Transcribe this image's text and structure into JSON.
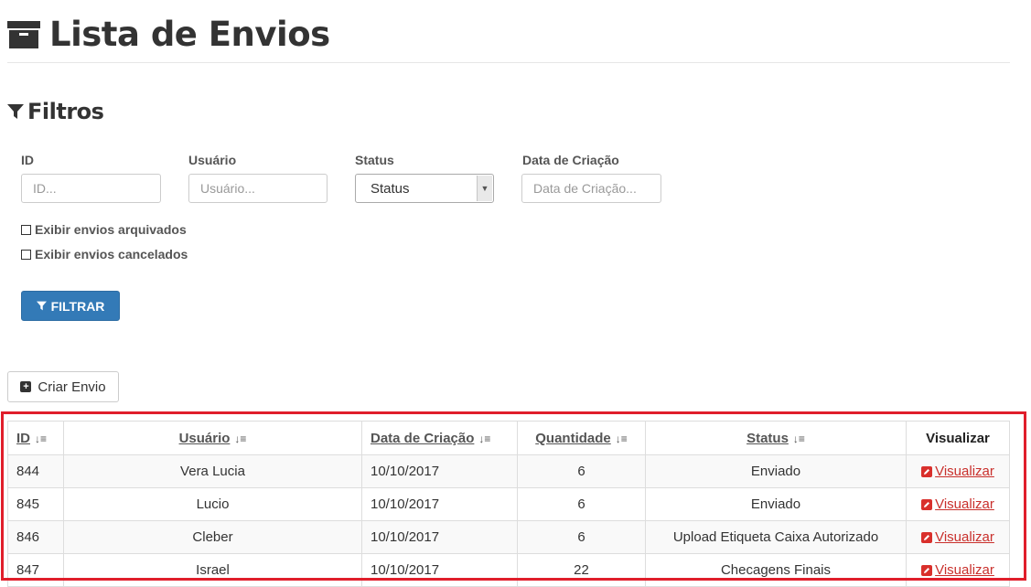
{
  "header": {
    "title": "Lista de Envios",
    "icon": "archive-box-icon"
  },
  "filters": {
    "title": "Filtros",
    "fields": {
      "id": {
        "label": "ID",
        "placeholder": "ID..."
      },
      "user": {
        "label": "Usuário",
        "placeholder": "Usuário..."
      },
      "status": {
        "label": "Status",
        "value": "Status"
      },
      "created": {
        "label": "Data de Criação",
        "placeholder": "Data de Criação..."
      }
    },
    "checkboxes": {
      "archived": "Exibir envios arquivados",
      "cancelled": "Exibir envios cancelados"
    },
    "filter_button": "FILTRAR"
  },
  "create_button": "Criar Envio",
  "table": {
    "columns": {
      "id": "ID",
      "user": "Usuário",
      "created": "Data de Criação",
      "quantity": "Quantidade",
      "status": "Status",
      "view": "Visualizar"
    },
    "rows": [
      {
        "id": "844",
        "user": "Vera Lucia",
        "created": "10/10/2017",
        "quantity": "6",
        "status": "Enviado",
        "view": "Visualizar"
      },
      {
        "id": "845",
        "user": "Lucio",
        "created": "10/10/2017",
        "quantity": "6",
        "status": "Enviado",
        "view": "Visualizar"
      },
      {
        "id": "846",
        "user": "Cleber",
        "created": "10/10/2017",
        "quantity": "6",
        "status": "Upload Etiqueta Caixa Autorizado",
        "view": "Visualizar"
      },
      {
        "id": "847",
        "user": "Israel",
        "created": "10/10/2017",
        "quantity": "22",
        "status": "Checagens Finais",
        "view": "Visualizar"
      }
    ]
  },
  "colors": {
    "primary": "#337ab7",
    "link_red": "#c9302c",
    "highlight": "#e01e2b"
  }
}
